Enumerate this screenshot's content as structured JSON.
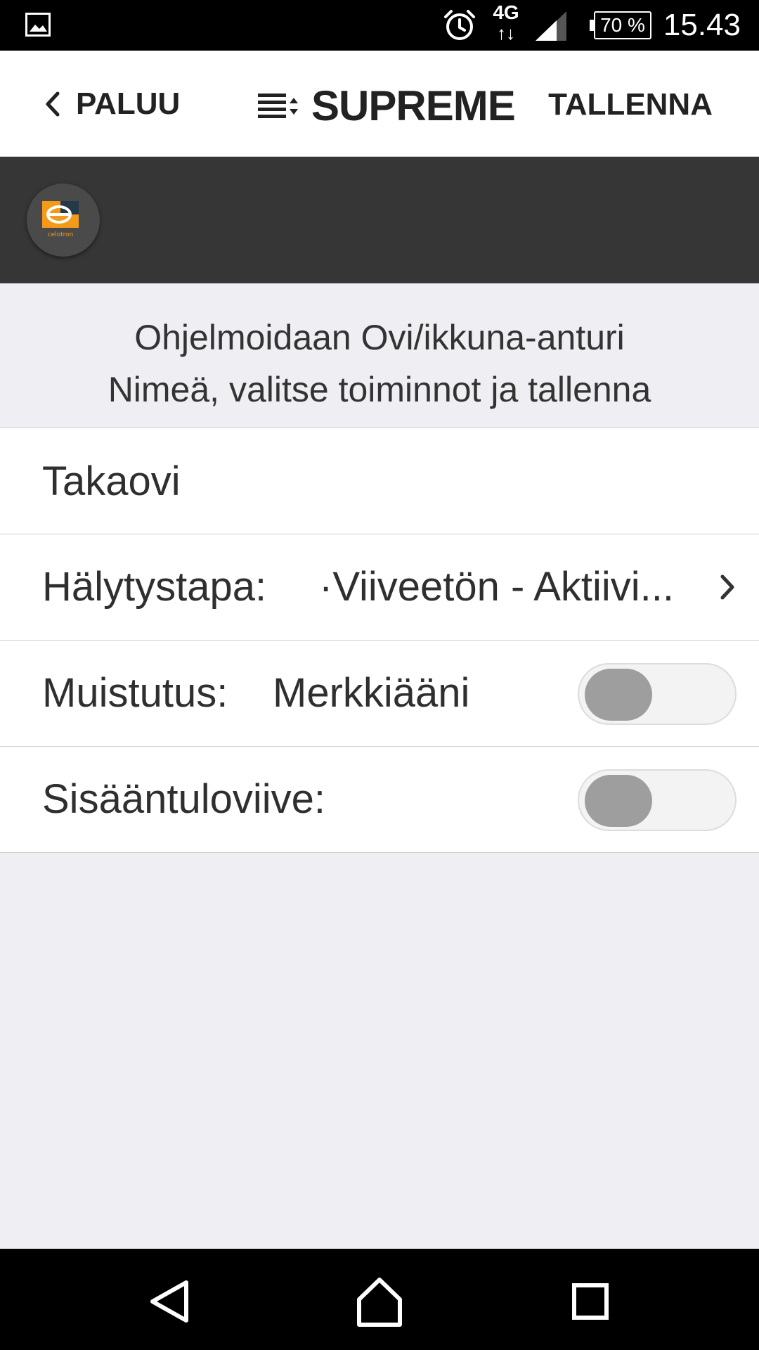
{
  "status_bar": {
    "network": "4G",
    "network_arrows": "↑↓",
    "battery": "70 %",
    "time": "15.43"
  },
  "header": {
    "back_label": "PALUU",
    "title": "SUPREME",
    "save_label": "TALLENNA"
  },
  "logo": {
    "text": "celotron",
    "accent_color": "#f39a1b"
  },
  "info": {
    "line1": "Ohjelmoidaan Ovi/ikkuna-anturi",
    "line2": "Nimeä, valitse toiminnot ja tallenna"
  },
  "form": {
    "name_value": "Takaovi",
    "alarm_label": "Hälytystapa:",
    "alarm_value": "·Viiveetön - Aktiivi...",
    "reminder_label": "Muistutus:",
    "reminder_value": "Merkkiääni",
    "reminder_on": false,
    "entry_delay_label": "Sisääntuloviive:",
    "entry_delay_on": false
  },
  "icons": {
    "status": [
      "gallery-icon",
      "alarm-clock-icon",
      "signal-icon",
      "battery-icon"
    ],
    "nav": [
      "back-nav-icon",
      "home-nav-icon",
      "recents-nav-icon"
    ]
  }
}
